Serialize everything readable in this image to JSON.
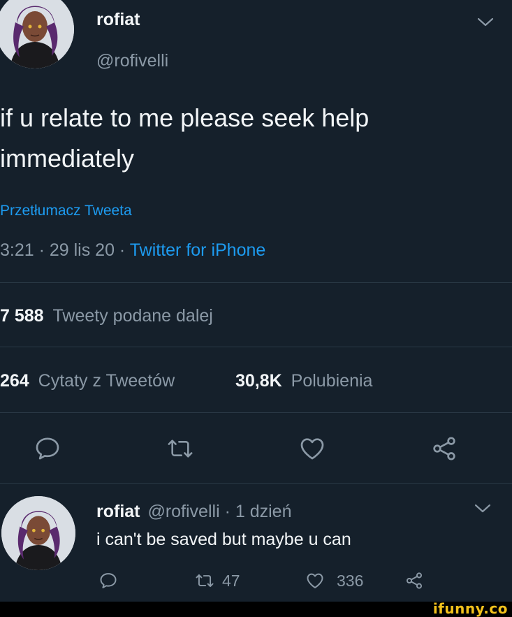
{
  "tweet": {
    "display_name": "rofiat",
    "handle": "@rofivelli",
    "text_line1": "if u relate to me please seek help",
    "text_line2": "immediately",
    "translate_label": "Przetłumacz Tweeta",
    "time": "3:21 · 29 lis 20 · ",
    "client": "Twitter for iPhone",
    "retweets_count": "7 588",
    "retweets_label": "Tweety podane dalej",
    "quotes_count": "264",
    "quotes_label": "Cytaty z Tweetów",
    "likes_count": "30,8K",
    "likes_label": "Polubienia"
  },
  "reply": {
    "display_name": "rofiat",
    "handle": "@rofivelli",
    "separator": " · ",
    "time": "1 dzień",
    "text": "i can't be saved but maybe u can",
    "retweet_count": "47",
    "like_count": "336"
  },
  "watermark": "ifunny.co",
  "colors": {
    "background": "#15202b",
    "accent": "#1d9bf0",
    "muted": "#8b99a6",
    "divider": "#2a3946",
    "watermark": "#f3c21c"
  },
  "icons": {
    "reply": "speech-bubble-icon",
    "retweet": "retweet-arrows-icon",
    "like": "heart-icon",
    "share": "share-icon",
    "menu": "chevron-down-icon"
  }
}
